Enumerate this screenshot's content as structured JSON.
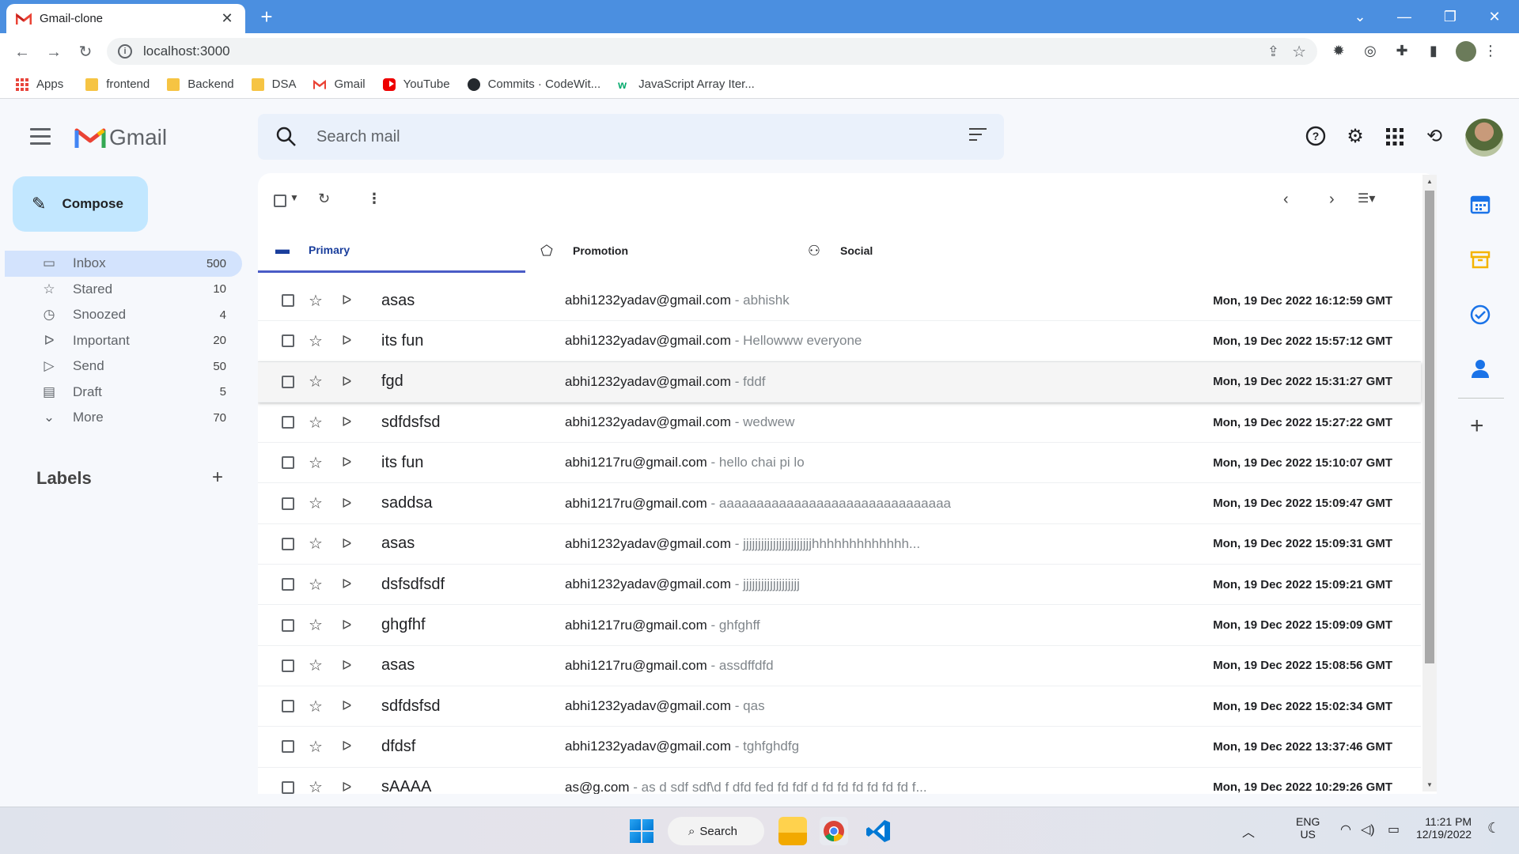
{
  "browser": {
    "tab_title": "Gmail-clone",
    "url": "localhost:3000",
    "bookmarks": [
      {
        "label": "Apps",
        "icon": "apps-grid-icon"
      },
      {
        "label": "frontend",
        "icon": "folder-icon"
      },
      {
        "label": "Backend",
        "icon": "folder-icon"
      },
      {
        "label": "DSA",
        "icon": "folder-icon"
      },
      {
        "label": "Gmail",
        "icon": "gmail-icon"
      },
      {
        "label": "YouTube",
        "icon": "youtube-icon"
      },
      {
        "label": "Commits · CodeWit...",
        "icon": "github-icon"
      },
      {
        "label": "JavaScript Array Iter...",
        "icon": "w3schools-icon"
      }
    ]
  },
  "header": {
    "logo_text": "Gmail",
    "search_placeholder": "Search mail"
  },
  "sidebar": {
    "compose_label": "Compose",
    "items": [
      {
        "label": "Inbox",
        "count": "500",
        "icon": "inbox-icon"
      },
      {
        "label": "Stared",
        "count": "10",
        "icon": "star-icon"
      },
      {
        "label": "Snoozed",
        "count": "4",
        "icon": "clock-icon"
      },
      {
        "label": "Important",
        "count": "20",
        "icon": "label-important-icon"
      },
      {
        "label": "Send",
        "count": "50",
        "icon": "send-icon"
      },
      {
        "label": "Draft",
        "count": "5",
        "icon": "draft-icon"
      },
      {
        "label": "More",
        "count": "70",
        "icon": "chevron-down-icon"
      }
    ],
    "labels_heading": "Labels"
  },
  "tabs": [
    {
      "label": "Primary",
      "icon": "inbox-icon",
      "active": true
    },
    {
      "label": "Promotion",
      "icon": "tag-icon",
      "active": false
    },
    {
      "label": "Social",
      "icon": "people-icon",
      "active": false
    }
  ],
  "emails": [
    {
      "subject": "asas",
      "from": "abhi1232yadav@gmail.com",
      "snippet": "abhishk",
      "date": "Mon, 19 Dec 2022 16:12:59 GMT"
    },
    {
      "subject": "its fun",
      "from": "abhi1232yadav@gmail.com",
      "snippet": "Hellowww everyone",
      "date": "Mon, 19 Dec 2022 15:57:12 GMT"
    },
    {
      "subject": "fgd",
      "from": "abhi1232yadav@gmail.com",
      "snippet": "fddf",
      "date": "Mon, 19 Dec 2022 15:31:27 GMT"
    },
    {
      "subject": "sdfdsfsd",
      "from": "abhi1232yadav@gmail.com",
      "snippet": "wedwew",
      "date": "Mon, 19 Dec 2022 15:27:22 GMT"
    },
    {
      "subject": "its fun",
      "from": "abhi1217ru@gmail.com",
      "snippet": "hello chai pi lo",
      "date": "Mon, 19 Dec 2022 15:10:07 GMT"
    },
    {
      "subject": "saddsa",
      "from": "abhi1217ru@gmail.com",
      "snippet": "aaaaaaaaaaaaaaaaaaaaaaaaaaaaaaa",
      "date": "Mon, 19 Dec 2022 15:09:47 GMT"
    },
    {
      "subject": "asas",
      "from": "abhi1232yadav@gmail.com",
      "snippet": "jjjjjjjjjjjjjjjjjjjjjjjhhhhhhhhhhhhh...",
      "date": "Mon, 19 Dec 2022 15:09:31 GMT"
    },
    {
      "subject": "dsfsdfsdf",
      "from": "abhi1232yadav@gmail.com",
      "snippet": "jjjjjjjjjjjjjjjjjjj",
      "date": "Mon, 19 Dec 2022 15:09:21 GMT"
    },
    {
      "subject": "ghgfhf",
      "from": "abhi1217ru@gmail.com",
      "snippet": "ghfghff",
      "date": "Mon, 19 Dec 2022 15:09:09 GMT"
    },
    {
      "subject": "asas",
      "from": "abhi1217ru@gmail.com",
      "snippet": "assdffdfd",
      "date": "Mon, 19 Dec 2022 15:08:56 GMT"
    },
    {
      "subject": "sdfdsfsd",
      "from": "abhi1232yadav@gmail.com",
      "snippet": "qas",
      "date": "Mon, 19 Dec 2022 15:02:34 GMT"
    },
    {
      "subject": "dfdsf",
      "from": "abhi1232yadav@gmail.com",
      "snippet": "tghfghdfg",
      "date": "Mon, 19 Dec 2022 13:37:46 GMT"
    },
    {
      "subject": "sAAAA",
      "from": "as@g.com",
      "snippet": "as d sdf sdf\\d f dfd fed fd fdf d fd fd fd fd fd fd f...",
      "date": "Mon, 19 Dec 2022 10:29:26 GMT"
    }
  ],
  "taskbar": {
    "search_label": "Search",
    "lang_top": "ENG",
    "lang_bottom": "US",
    "time": "11:21 PM",
    "date": "12/19/2022"
  },
  "colors": {
    "compose_bg": "#c2e7ff",
    "active_nav_bg": "#d3e3fd",
    "primary_tab": "#4a5cc6",
    "titlebar": "#4b8fe0"
  }
}
